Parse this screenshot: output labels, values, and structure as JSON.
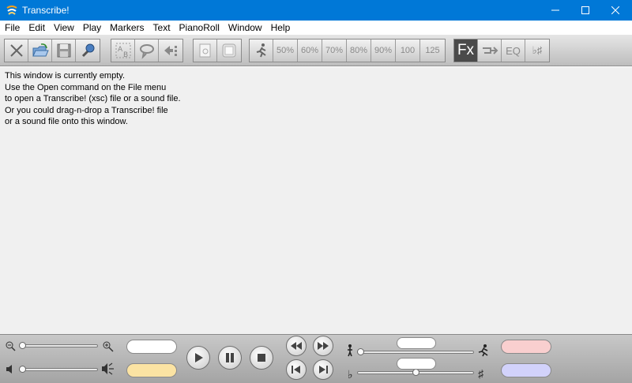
{
  "window": {
    "title": "Transcribe!",
    "controls": [
      "minimize",
      "maximize",
      "close"
    ]
  },
  "menu": {
    "items": [
      "File",
      "Edit",
      "View",
      "Play",
      "Markers",
      "Text",
      "PianoRoll",
      "Window",
      "Help"
    ]
  },
  "toolbar": {
    "speeds": [
      "50%",
      "60%",
      "70%",
      "80%",
      "90%",
      "100",
      "125"
    ],
    "fx_label": "Fx",
    "eq_label": "EQ",
    "accidentals_label": "♭♯"
  },
  "content": {
    "lines": [
      "This window is currently empty.",
      "Use the Open command on the File menu",
      "to open a Transcribe! (xsc) file or a sound file.",
      "Or you could drag-n-drop a Transcribe! file",
      "or a sound file onto this window."
    ]
  },
  "bottom": {
    "zoom_level": 0,
    "volume_level": 0,
    "speed_level": 0,
    "pitch_level": 0.5,
    "flat_symbol": "♭",
    "sharp_symbol": "♯"
  },
  "colors": {
    "titlebar": "#0078d7",
    "pill_white": "#ffffff",
    "pill_yellow": "#fbe3a3",
    "pill_pink": "#f9cfcf",
    "pill_lavender": "#d2d2fb"
  }
}
